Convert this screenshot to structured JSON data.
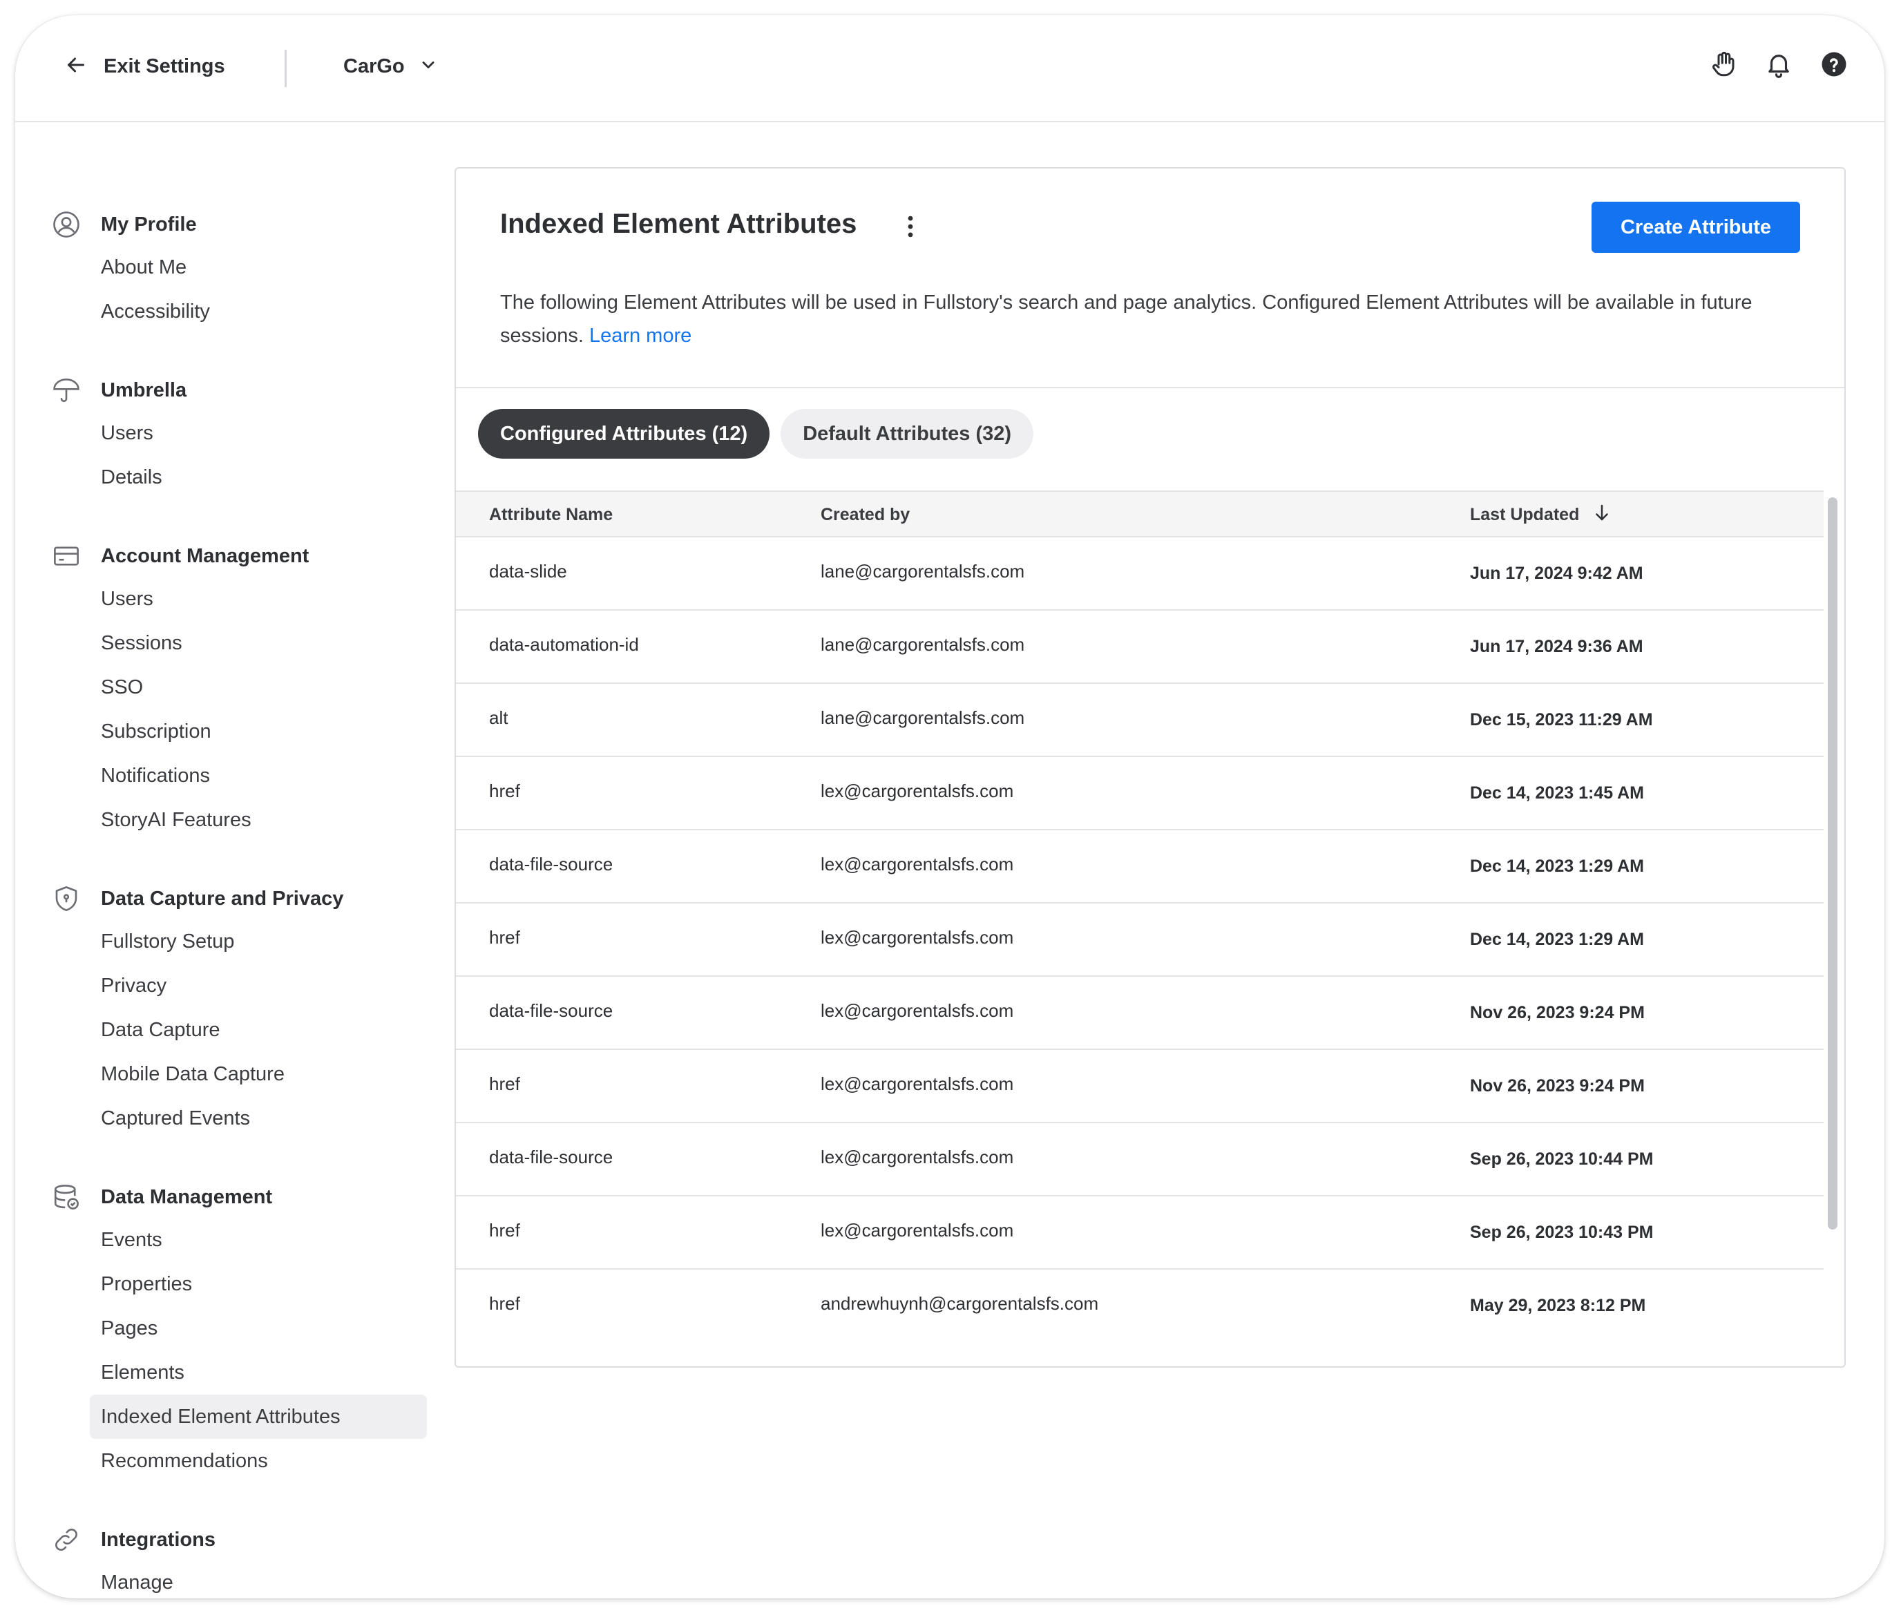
{
  "topbar": {
    "exit_label": "Exit Settings",
    "org_name": "CarGo",
    "icons": [
      "hand-icon",
      "bell-icon",
      "help-icon"
    ]
  },
  "sidebar": {
    "sections": [
      {
        "title": "My Profile",
        "icon": "user-circle-icon",
        "items": [
          "About Me",
          "Accessibility"
        ]
      },
      {
        "title": "Umbrella",
        "icon": "umbrella-icon",
        "items": [
          "Users",
          "Details"
        ]
      },
      {
        "title": "Account Management",
        "icon": "credit-card-icon",
        "items": [
          "Users",
          "Sessions",
          "SSO",
          "Subscription",
          "Notifications",
          "StoryAI Features"
        ]
      },
      {
        "title": "Data Capture and Privacy",
        "icon": "shield-icon",
        "items": [
          "Fullstory Setup",
          "Privacy",
          "Data Capture",
          "Mobile Data Capture",
          "Captured Events"
        ]
      },
      {
        "title": "Data Management",
        "icon": "database-icon",
        "items": [
          "Events",
          "Properties",
          "Pages",
          "Elements",
          "Indexed Element Attributes",
          "Recommendations"
        ]
      },
      {
        "title": "Integrations",
        "icon": "link-icon",
        "items": [
          "Manage"
        ]
      }
    ],
    "active_item": "Indexed Element Attributes"
  },
  "main": {
    "title": "Indexed Element Attributes",
    "create_button": "Create Attribute",
    "description": "The following Element Attributes will be used in Fullstory's search and page analytics. Configured Element Attributes will be available in future sessions.",
    "learn_more": "Learn more",
    "tabs": [
      {
        "label": "Configured Attributes (12)",
        "active": true
      },
      {
        "label": "Default Attributes (32)",
        "active": false
      }
    ],
    "table": {
      "headers": [
        "Attribute Name",
        "Created by",
        "Last Updated"
      ],
      "sort_icon": "arrow-down-icon",
      "rows": [
        [
          "data-slide",
          "lane@cargorentalsfs.com",
          "Jun 17, 2024 9:42 AM"
        ],
        [
          "data-automation-id",
          "lane@cargorentalsfs.com",
          "Jun 17, 2024 9:36 AM"
        ],
        [
          "alt",
          "lane@cargorentalsfs.com",
          "Dec 15, 2023 11:29 AM"
        ],
        [
          "href",
          "lex@cargorentalsfs.com",
          "Dec 14, 2023 1:45 AM"
        ],
        [
          "data-file-source",
          "lex@cargorentalsfs.com",
          "Dec 14, 2023 1:29 AM"
        ],
        [
          "href",
          "lex@cargorentalsfs.com",
          "Dec 14, 2023 1:29 AM"
        ],
        [
          "data-file-source",
          "lex@cargorentalsfs.com",
          "Nov 26, 2023 9:24 PM"
        ],
        [
          "href",
          "lex@cargorentalsfs.com",
          "Nov 26, 2023 9:24 PM"
        ],
        [
          "data-file-source",
          "lex@cargorentalsfs.com",
          "Sep 26, 2023 10:44 PM"
        ],
        [
          "href",
          "lex@cargorentalsfs.com",
          "Sep 26, 2023 10:43 PM"
        ],
        [
          "href",
          "andrewhuynh@cargorentalsfs.com",
          "May 29, 2023 8:12 PM"
        ]
      ]
    }
  },
  "colors": {
    "accent": "#1373f1",
    "tab_active_bg": "#3a3c40",
    "tab_inactive_bg": "#efeff1",
    "sidebar_active_bg": "#efeff1"
  }
}
